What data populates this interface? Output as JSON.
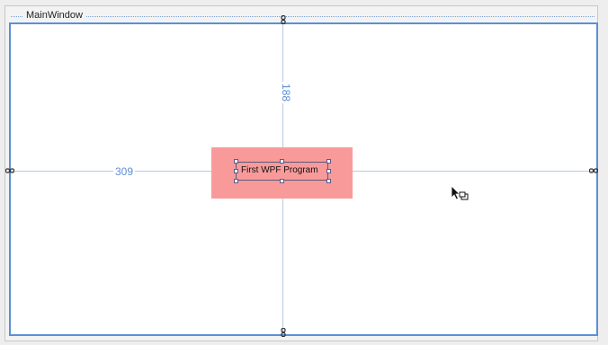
{
  "window": {
    "title": "MainWindow"
  },
  "designer": {
    "dimension_left": "309",
    "dimension_top": "188"
  },
  "label_control": {
    "text": "First WPF Program"
  },
  "colors": {
    "grid_border": "#5b8fd6",
    "guide_line": "#b9c9e2",
    "margin_highlight": "#f99a9a",
    "dimension_text": "#5b8fd6"
  },
  "icons": {
    "anchor": "chain-link-icon",
    "cursor": "pointer-copy-cursor-icon"
  }
}
